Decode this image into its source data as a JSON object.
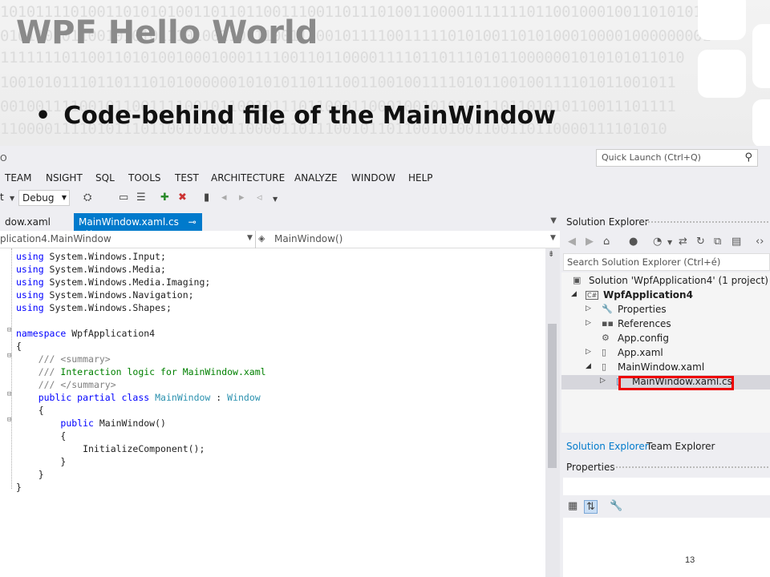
{
  "slide": {
    "title": "WPF Hello World",
    "bullet": "Code-behind file of the MainWindow",
    "page_number": "13",
    "binary_rows": [
      "10101111010011010101001101101100111001101110100110000111111101100100010011010101",
      "010110101100101010111010011011100111001011110011111010100110101000100001000000001",
      "111111101100110101001000100011110011011000011110110111010110000001010101011010",
      "10010101110110111010100000010101011011100110010011110101100100111101011001011",
      "00100111100101100111100101100101110110001100010010101011101101010110011101111",
      "1100001111010111011001010011000011011100101101100101001100110110000111101010"
    ]
  },
  "ide": {
    "title_fragment": "O",
    "quick_launch_placeholder": "Quick Launch (Ctrl+Q)",
    "menu": [
      "TEAM",
      "NSIGHT",
      "SQL",
      "TOOLS",
      "TEST",
      "ARCHITECTURE",
      "ANALYZE",
      "WINDOW",
      "HELP"
    ],
    "toolbar": {
      "platform_fragment": "t",
      "configuration": "Debug"
    },
    "doc_tabs": [
      {
        "label": "dow.xaml"
      },
      {
        "label": "MainWindow.xaml.cs"
      }
    ],
    "nav": {
      "class_path": "plication4.MainWindow",
      "member": "MainWindow()"
    },
    "code_lines": [
      [
        {
          "t": "using",
          "c": "kw"
        },
        {
          "t": " System.Windows.Input;"
        }
      ],
      [
        {
          "t": "using",
          "c": "kw"
        },
        {
          "t": " System.Windows.Media;"
        }
      ],
      [
        {
          "t": "using",
          "c": "kw"
        },
        {
          "t": " System.Windows.Media.Imaging;"
        }
      ],
      [
        {
          "t": "using",
          "c": "kw"
        },
        {
          "t": " System.Windows.Navigation;"
        }
      ],
      [
        {
          "t": "using",
          "c": "kw"
        },
        {
          "t": " System.Windows.Shapes;"
        }
      ],
      [],
      [
        {
          "t": "namespace",
          "c": "kw"
        },
        {
          "t": " WpfApplication4"
        }
      ],
      [
        {
          "t": "{"
        }
      ],
      [
        {
          "t": "    "
        },
        {
          "t": "/// ",
          "c": "cmg"
        },
        {
          "t": "<summary>",
          "c": "cmg"
        }
      ],
      [
        {
          "t": "    "
        },
        {
          "t": "/// ",
          "c": "cmg"
        },
        {
          "t": "Interaction logic for MainWindow.xaml",
          "c": "cm"
        }
      ],
      [
        {
          "t": "    "
        },
        {
          "t": "/// ",
          "c": "cmg"
        },
        {
          "t": "</summary>",
          "c": "cmg"
        }
      ],
      [
        {
          "t": "    "
        },
        {
          "t": "public partial class",
          "c": "kw"
        },
        {
          "t": " "
        },
        {
          "t": "MainWindow",
          "c": "ty"
        },
        {
          "t": " : "
        },
        {
          "t": "Window",
          "c": "ty"
        }
      ],
      [
        {
          "t": "    {"
        }
      ],
      [
        {
          "t": "        "
        },
        {
          "t": "public",
          "c": "kw"
        },
        {
          "t": " MainWindow()"
        }
      ],
      [
        {
          "t": "        {"
        }
      ],
      [
        {
          "t": "            InitializeComponent();"
        }
      ],
      [
        {
          "t": "        }"
        }
      ],
      [
        {
          "t": "    }"
        }
      ],
      [
        {
          "t": "}"
        }
      ]
    ],
    "solution_explorer": {
      "title": "Solution Explorer",
      "search_placeholder": "Search Solution Explorer (Ctrl+é)",
      "items": [
        {
          "label": "Solution 'WpfApplication4' (1 project)",
          "bold": false
        },
        {
          "label": "WpfApplication4",
          "bold": true
        },
        {
          "label": "Properties"
        },
        {
          "label": "References"
        },
        {
          "label": "App.config"
        },
        {
          "label": "App.xaml"
        },
        {
          "label": "MainWindow.xaml"
        },
        {
          "label": "MainWindow.xaml.cs"
        }
      ],
      "bottom_tabs": [
        "Solution Explorer",
        "Team Explorer"
      ]
    },
    "properties": {
      "title": "Properties"
    }
  }
}
